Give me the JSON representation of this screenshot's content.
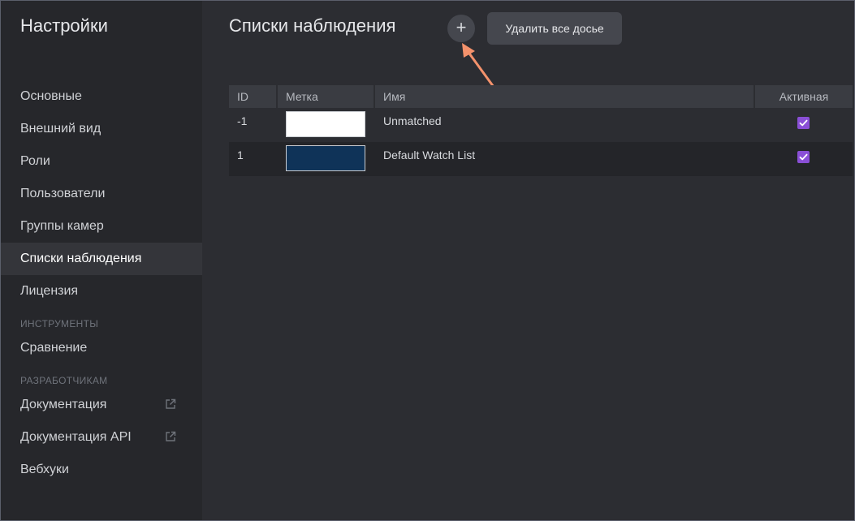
{
  "sidebar": {
    "title": "Настройки",
    "items": [
      {
        "label": "Основные",
        "active": false
      },
      {
        "label": "Внешний вид",
        "active": false
      },
      {
        "label": "Роли",
        "active": false
      },
      {
        "label": "Пользователи",
        "active": false
      },
      {
        "label": "Группы камер",
        "active": false
      },
      {
        "label": "Списки наблюдения",
        "active": true
      },
      {
        "label": "Лицензия",
        "active": false
      }
    ],
    "sections": [
      {
        "title": "ИНСТРУМЕНТЫ",
        "items": [
          {
            "label": "Сравнение"
          }
        ]
      },
      {
        "title": "РАЗРАБОТЧИКАМ",
        "items": [
          {
            "label": "Документация",
            "icon": "external-link-icon"
          },
          {
            "label": "Документация API",
            "icon": "external-link-icon"
          },
          {
            "label": "Вебхуки"
          }
        ]
      }
    ]
  },
  "main": {
    "title": "Списки наблюдения",
    "add_button_label": "+",
    "delete_button_label": "Удалить все досье",
    "annotation_arrow_color": "#f4926c"
  },
  "table": {
    "columns": [
      "ID",
      "Метка",
      "Имя",
      "Активная"
    ],
    "rows": [
      {
        "id": "-1",
        "color": "#ffffff",
        "name": "Unmatched",
        "active": true
      },
      {
        "id": "1",
        "color": "#0f3358",
        "name": "Default Watch List",
        "active": true
      }
    ]
  },
  "colors": {
    "accent_checkbox": "#8a4fd6",
    "sidebar_bg": "#26272b",
    "main_bg": "#2c2d32"
  }
}
